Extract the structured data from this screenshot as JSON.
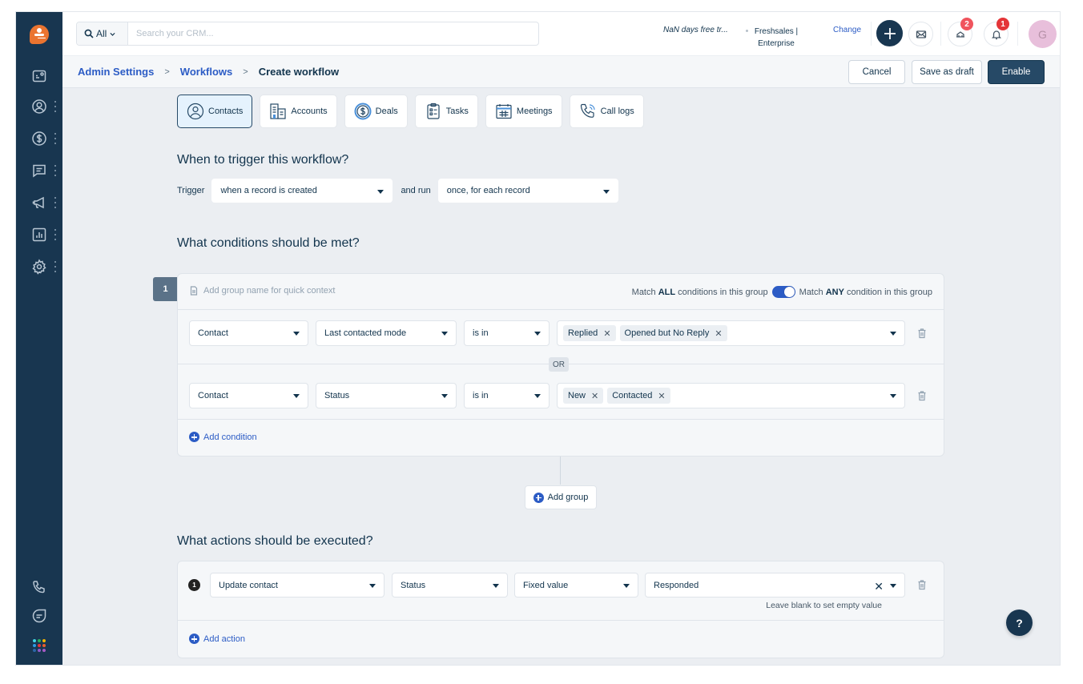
{
  "sidebar": {
    "logo": "freshsales-logo",
    "items": [
      {
        "name": "sidebar-item-dashboard",
        "icon": "dashboard-icon"
      },
      {
        "name": "sidebar-item-contacts",
        "icon": "contact-icon"
      },
      {
        "name": "sidebar-item-deals",
        "icon": "dollar-icon"
      },
      {
        "name": "sidebar-item-conversations",
        "icon": "chat-icon"
      },
      {
        "name": "sidebar-item-campaigns",
        "icon": "megaphone-icon"
      },
      {
        "name": "sidebar-item-reports",
        "icon": "chart-icon"
      },
      {
        "name": "sidebar-item-settings",
        "icon": "gear-icon"
      }
    ],
    "bottom_items": [
      {
        "name": "sidebar-item-phone",
        "icon": "phone-icon"
      },
      {
        "name": "sidebar-item-chat",
        "icon": "chat-bubble-icon"
      },
      {
        "name": "sidebar-item-apps",
        "icon": "apps-grid-icon"
      }
    ],
    "apps_colors": [
      "#3fd5e6",
      "#27ae60",
      "#f5b400",
      "#2d9be3",
      "#e43538",
      "#e6602d",
      "#2b67a8",
      "#8f59c9",
      "#a65bc4"
    ]
  },
  "topbar": {
    "search_scope": "All",
    "search_placeholder": "Search your CRM...",
    "search_value": "",
    "trial_text": "NaN days free tr...",
    "plan_text": "Freshsales | Enterprise",
    "change_label": "Change",
    "email_icon": "envelope-icon",
    "notifications": [
      {
        "icon": "bullhorn-icon",
        "count": "2",
        "color": "#f0545d"
      },
      {
        "icon": "bell-icon",
        "count": "1",
        "color": "#e43538"
      }
    ],
    "avatar_initial": "G",
    "avatar_color": "#e8bfdb"
  },
  "breadcrumb": {
    "items": [
      "Admin Settings",
      "Workflows"
    ],
    "current": "Create workflow",
    "separator": ">"
  },
  "buttons": {
    "cancel": "Cancel",
    "save_draft": "Save as draft",
    "enable": "Enable"
  },
  "entity_tabs": [
    {
      "label": "Contacts",
      "icon": "contact-icon",
      "active": true
    },
    {
      "label": "Accounts",
      "icon": "building-icon",
      "active": false
    },
    {
      "label": "Deals",
      "icon": "dollar-coin-icon",
      "active": false
    },
    {
      "label": "Tasks",
      "icon": "clipboard-icon",
      "active": false
    },
    {
      "label": "Meetings",
      "icon": "calendar-icon",
      "active": false
    },
    {
      "label": "Call logs",
      "icon": "phone-call-icon",
      "active": false
    }
  ],
  "trigger": {
    "title": "When to trigger this workflow?",
    "trigger_label": "Trigger",
    "trigger_value": "when a record is created",
    "run_label": "and run",
    "run_value": "once, for each record"
  },
  "conditions": {
    "title": "What conditions should be met?",
    "groups": [
      {
        "number": "1",
        "name_placeholder": "Add group name for quick context",
        "match_all_prefix": "Match",
        "match_all_bold": "ALL",
        "match_all_suffix": "conditions in this group",
        "match_any_prefix": "Match",
        "match_any_bold": "ANY",
        "match_any_suffix": "condition in this group",
        "match_any_enabled": true,
        "operator": "OR",
        "rows": [
          {
            "entity": "Contact",
            "field": "Last contacted mode",
            "op": "is in",
            "values": [
              "Replied",
              "Opened but No Reply"
            ]
          },
          {
            "entity": "Contact",
            "field": "Status",
            "op": "is in",
            "values": [
              "New",
              "Contacted"
            ]
          }
        ],
        "add_condition_label": "Add condition"
      }
    ],
    "add_group_label": "Add group"
  },
  "actions": {
    "title": "What actions should be executed?",
    "items": [
      {
        "number": "1",
        "action": "Update contact",
        "field": "Status",
        "value_type": "Fixed value",
        "value": "Responded",
        "hint": "Leave blank to set empty value"
      }
    ],
    "add_action_label": "Add action"
  },
  "help_label": "?"
}
